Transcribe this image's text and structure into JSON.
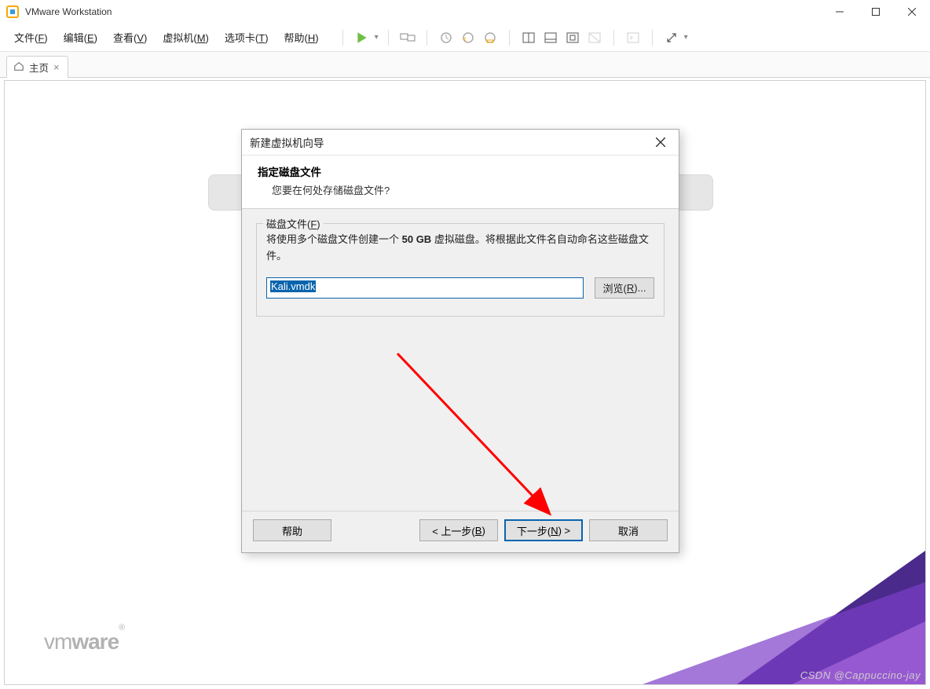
{
  "window": {
    "title": "VMware Workstation"
  },
  "menu": {
    "file": "文件(F)",
    "edit": "编辑(E)",
    "view": "查看(V)",
    "vm": "虚拟机(M)",
    "tabs": "选项卡(T)",
    "help": "帮助(H)"
  },
  "tab": {
    "home_label": "主页"
  },
  "dialog": {
    "title": "新建虚拟机向导",
    "heading": "指定磁盘文件",
    "subheading": "您要在何处存储磁盘文件?",
    "fieldset_label_pre": "磁盘文件(",
    "fieldset_label_key": "F",
    "fieldset_label_post": ")",
    "description_pre": "将使用多个磁盘文件创建一个 ",
    "description_size": "50 GB",
    "description_post": " 虚拟磁盘。将根据此文件名自动命名这些磁盘文件。",
    "filepath": "Kali.vmdk",
    "browse_pre": "浏览(",
    "browse_key": "R",
    "browse_post": ")...",
    "buttons": {
      "help": "帮助",
      "back_pre": "< 上一步(",
      "back_key": "B",
      "back_post": ")",
      "next_pre": "下一步(",
      "next_key": "N",
      "next_post": ") >",
      "cancel": "取消"
    }
  },
  "footer": {
    "vmware": "vmware",
    "watermark": "CSDN @Cappuccino-jay"
  }
}
